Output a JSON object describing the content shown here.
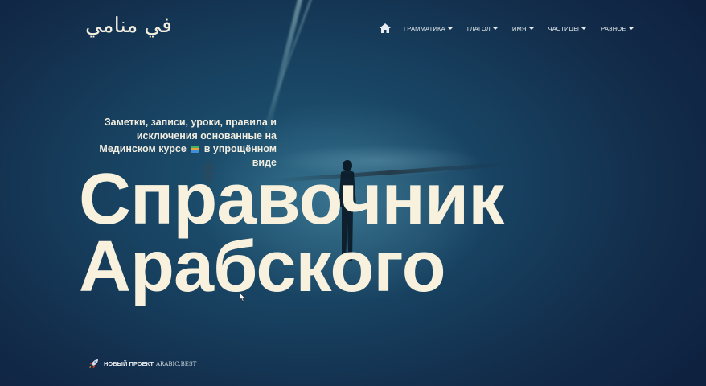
{
  "logo": {
    "text": "في منامي"
  },
  "nav": {
    "home_icon": "home-icon",
    "items": [
      {
        "label": "ГРАММАТИКА"
      },
      {
        "label": "ГЛАГОЛ"
      },
      {
        "label": "ИМЯ"
      },
      {
        "label": "ЧАСТИЦЫ"
      },
      {
        "label": "РАЗНОЕ"
      }
    ]
  },
  "hero": {
    "tagline_before": "Заметки, записи, уроки, правила и исключения основанные на Мединском курсе",
    "tagline_icon": "books-emoji-icon",
    "tagline_after": "в упрощённом виде",
    "title_line1": "Справочник",
    "title_line2": "Арабского"
  },
  "footer": {
    "icon": "rocket-icon",
    "label": "НОВЫЙ ПРОЕКТ",
    "domain": "ARABIC.BEST"
  },
  "colors": {
    "text_primary": "#f7f1dd",
    "background_dark": "#122c4a",
    "background_mid": "#1f5876"
  }
}
